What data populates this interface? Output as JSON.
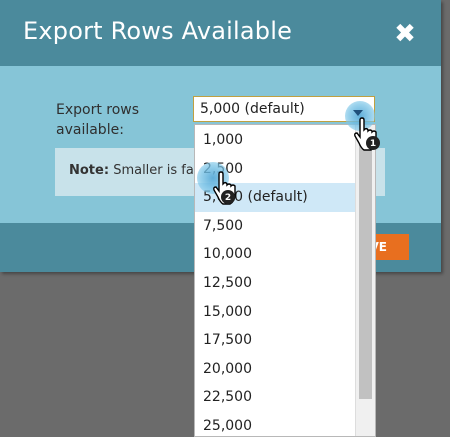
{
  "dialog": {
    "title": "Export Rows Available",
    "close_glyph": "✖",
    "field_label": "Export rows available:",
    "select_value": "5,000 (default)",
    "note_label": "Note:",
    "note_text": "Smaller is fas",
    "save_label": "VE"
  },
  "dropdown": {
    "options": [
      "1,000",
      "2,500",
      "5,000 (default)",
      "7,500",
      "10,000",
      "12,500",
      "15,000",
      "17,500",
      "20,000",
      "22,500",
      "25,000"
    ],
    "selected_index": 2
  },
  "annotations": {
    "step1": "1",
    "step2": "2"
  },
  "colors": {
    "header": "#4b8a9c",
    "body": "#86c5d7",
    "accent": "#e86f1f"
  }
}
